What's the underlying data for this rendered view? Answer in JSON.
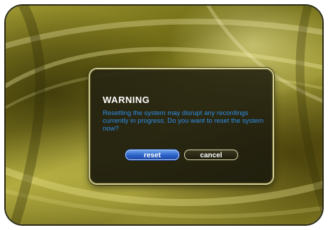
{
  "dialog": {
    "title": "WARNING",
    "message": "Resetting the system may disrupt any recordings currently in progress.  Do you want to reset the system now?",
    "buttons": {
      "reset_label": "reset",
      "cancel_label": "cancel"
    }
  },
  "colors": {
    "background_primary": "#8c8626",
    "message_text": "#2e8de8",
    "focused_button": "#2c62c8",
    "dialog_border": "#cfc98a"
  }
}
